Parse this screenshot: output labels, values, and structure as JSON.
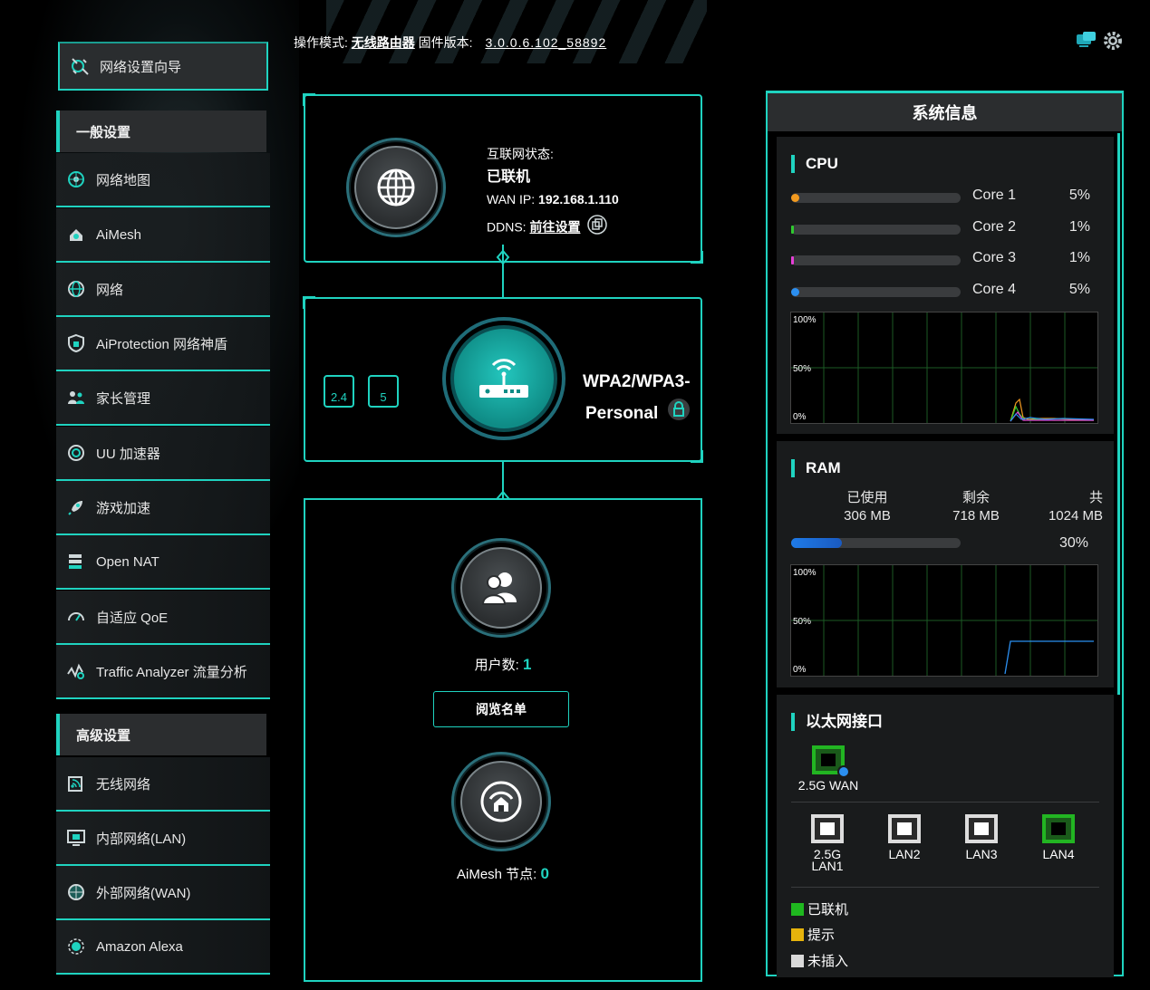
{
  "topbar": {
    "mode_label": "操作模式:",
    "mode_value": "无线路由器",
    "fw_label": "固件版本:",
    "fw_value": "3.0.0.6.102_58892"
  },
  "sidebar": {
    "wizard": "网络设置向导",
    "general_head": "一般设置",
    "general": [
      {
        "label": "网络地图",
        "icon": "network-map-icon"
      },
      {
        "label": "AiMesh",
        "icon": "aimesh-icon"
      },
      {
        "label": "网络",
        "icon": "globe-icon"
      },
      {
        "label": "AiProtection 网络神盾",
        "icon": "shield-icon"
      },
      {
        "label": "家长管理",
        "icon": "family-icon"
      },
      {
        "label": "UU 加速器",
        "icon": "uu-icon"
      },
      {
        "label": "游戏加速",
        "icon": "rocket-icon"
      },
      {
        "label": "Open NAT",
        "icon": "server-icon"
      },
      {
        "label": "自适应 QoE",
        "icon": "speedometer-icon"
      },
      {
        "label": "Traffic Analyzer 流量分析",
        "icon": "traffic-icon"
      }
    ],
    "advanced_head": "高级设置",
    "advanced": [
      {
        "label": "无线网络",
        "icon": "wireless-icon"
      },
      {
        "label": "内部网络(LAN)",
        "icon": "lan-icon"
      },
      {
        "label": "外部网络(WAN)",
        "icon": "wan-globe-icon"
      },
      {
        "label": "Amazon Alexa",
        "icon": "alexa-icon"
      }
    ]
  },
  "internet": {
    "status_label": "互联网状态:",
    "status_value": "已联机",
    "wan_ip_label": "WAN IP:",
    "wan_ip_value": "192.168.1.110",
    "ddns_label": "DDNS:",
    "ddns_link": "前往设置"
  },
  "router": {
    "band1": "2.4",
    "band2": "5",
    "security_line1": "WPA2/WPA3-",
    "security_line2": "Personal"
  },
  "clients": {
    "users_label": "用户数:",
    "users_count": "1",
    "view_list_button": "阅览名单",
    "aimesh_label": "AiMesh 节点:",
    "aimesh_count": "0"
  },
  "sysinfo": {
    "title": "系统信息",
    "cpu": {
      "title": "CPU",
      "cores": [
        {
          "label": "Core 1",
          "percent": "5%",
          "color": "#f29a1f"
        },
        {
          "label": "Core 2",
          "percent": "1%",
          "color": "#2fc92f"
        },
        {
          "label": "Core 3",
          "percent": "1%",
          "color": "#e53fd6"
        },
        {
          "label": "Core 4",
          "percent": "5%",
          "color": "#2b8ff0"
        }
      ],
      "graph_labels": [
        "100%",
        "50%",
        "0%"
      ]
    },
    "ram": {
      "title": "RAM",
      "used_label": "已使用",
      "used_value": "306 MB",
      "free_label": "剩余",
      "free_value": "718 MB",
      "total_label": "共",
      "total_value": "1024 MB",
      "percent": "30%",
      "usage_fraction": 0.3,
      "graph_labels": [
        "100%",
        "50%",
        "0%"
      ]
    },
    "ethernet": {
      "title": "以太网接口",
      "wan_port": "2.5G WAN",
      "lan_ports": [
        {
          "label_1": "2.5G",
          "label_2": "LAN1",
          "state": "unplugged"
        },
        {
          "label_1": "LAN2",
          "label_2": "",
          "state": "unplugged"
        },
        {
          "label_1": "LAN3",
          "label_2": "",
          "state": "unplugged"
        },
        {
          "label_1": "LAN4",
          "label_2": "",
          "state": "connected"
        }
      ],
      "legend": [
        {
          "label": "已联机",
          "color": "#1fb81f"
        },
        {
          "label": "提示",
          "color": "#e6b30c"
        },
        {
          "label": "未插入",
          "color": "#d9d9d9"
        }
      ]
    }
  },
  "colors": {
    "accent": "#1fd3c0",
    "panel": "#191b1c"
  }
}
